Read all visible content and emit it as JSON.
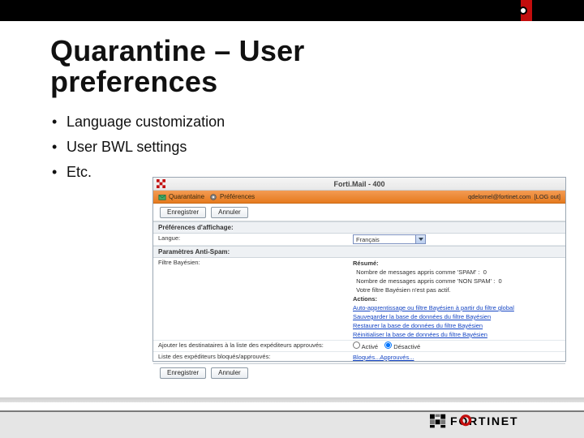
{
  "slide": {
    "title_line1": "Quarantine – User",
    "title_line2": "preferences",
    "bullets": [
      "Language customization",
      "User BWL settings",
      "Etc."
    ]
  },
  "app": {
    "product": "Forti.Mail - 400",
    "tabs": {
      "quarantine": "Quarantaine",
      "prefs": "Préférences"
    },
    "user": "qdelomel@fortinet.com",
    "logout": "[LOG out]",
    "buttons": {
      "save": "Enregistrer",
      "cancel": "Annuler"
    },
    "display": {
      "heading": "Préférences d'affichage:",
      "language_label": "Langue:",
      "language_value": "Français"
    },
    "antispam": {
      "heading": "Paramètres Anti-Spam:",
      "filter_label": "Filtre Bayésien:",
      "summary_heading": "Résumé:",
      "summary_spam": "Nombre de messages appris comme 'SPAM' :",
      "summary_spam_count": "0",
      "summary_nonspam": "Nombre de messages appris comme 'NON SPAM' :",
      "summary_nonspam_count": "0",
      "summary_inactive": "Votre filtre Bayésien n'est pas actif.",
      "actions_heading": "Actions:",
      "action_auto": "Auto-apprentissage ou filtre Bayésien à partir du filtre global",
      "action_save": "Sauvegarder la base de données du filtre Bayésien",
      "action_restore": "Restaurer la base de données du filtre Bayésien",
      "action_reset": "Réinitialiser la base de données du filtre Bayésien",
      "learn_label": "Ajouter les destinataires à la liste des expéditeurs approuvés:",
      "learn_on": "Activé",
      "learn_off": "Désactivé",
      "bwl_label": "Liste des expéditeurs bloqués/approuvés:",
      "bwl_link": "Bloqués...Approuvés..."
    }
  },
  "brand": "FORTINET"
}
